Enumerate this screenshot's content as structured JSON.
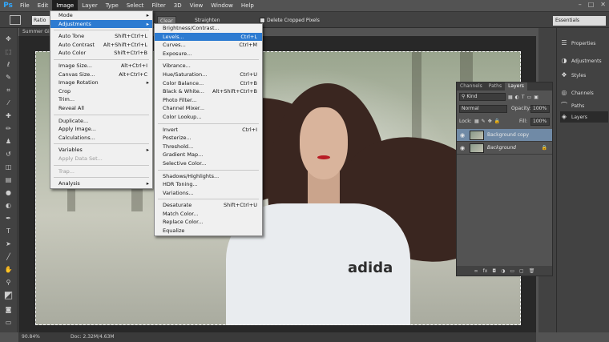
{
  "app": {
    "logo": "Ps"
  },
  "menubar": {
    "items": [
      "File",
      "Edit",
      "Image",
      "Layer",
      "Type",
      "Select",
      "Filter",
      "3D",
      "View",
      "Window",
      "Help"
    ],
    "active": "Image"
  },
  "options_bar": {
    "ratio": "Ratio",
    "clear": "Clear",
    "straighten": "Straighten",
    "delete_cropped": "Delete Cropped Pixels",
    "workspace": "Essentials"
  },
  "document": {
    "tab": "Summer Gi...",
    "zoom": "90.84%",
    "doc_size": "Doc: 2.32M/4.63M"
  },
  "image_menu": [
    {
      "label": "Mode",
      "submenu": true
    },
    {
      "label": "Adjustments",
      "submenu": true,
      "highlight": true
    },
    {
      "sep": true
    },
    {
      "label": "Auto Tone",
      "shortcut": "Shift+Ctrl+L"
    },
    {
      "label": "Auto Contrast",
      "shortcut": "Alt+Shift+Ctrl+L"
    },
    {
      "label": "Auto Color",
      "shortcut": "Shift+Ctrl+B"
    },
    {
      "sep": true
    },
    {
      "label": "Image Size...",
      "shortcut": "Alt+Ctrl+I"
    },
    {
      "label": "Canvas Size...",
      "shortcut": "Alt+Ctrl+C"
    },
    {
      "label": "Image Rotation",
      "submenu": true
    },
    {
      "label": "Crop"
    },
    {
      "label": "Trim..."
    },
    {
      "label": "Reveal All"
    },
    {
      "sep": true
    },
    {
      "label": "Duplicate..."
    },
    {
      "label": "Apply Image..."
    },
    {
      "label": "Calculations..."
    },
    {
      "sep": true
    },
    {
      "label": "Variables",
      "submenu": true
    },
    {
      "label": "Apply Data Set...",
      "disabled": true
    },
    {
      "sep": true
    },
    {
      "label": "Trap...",
      "disabled": true
    },
    {
      "sep": true
    },
    {
      "label": "Analysis",
      "submenu": true
    }
  ],
  "adjust_menu": [
    {
      "label": "Brightness/Contrast..."
    },
    {
      "label": "Levels...",
      "shortcut": "Ctrl+L",
      "highlight": true
    },
    {
      "label": "Curves...",
      "shortcut": "Ctrl+M"
    },
    {
      "label": "Exposure..."
    },
    {
      "sep": true
    },
    {
      "label": "Vibrance..."
    },
    {
      "label": "Hue/Saturation...",
      "shortcut": "Ctrl+U"
    },
    {
      "label": "Color Balance...",
      "shortcut": "Ctrl+B"
    },
    {
      "label": "Black & White...",
      "shortcut": "Alt+Shift+Ctrl+B"
    },
    {
      "label": "Photo Filter..."
    },
    {
      "label": "Channel Mixer..."
    },
    {
      "label": "Color Lookup..."
    },
    {
      "sep": true
    },
    {
      "label": "Invert",
      "shortcut": "Ctrl+I"
    },
    {
      "label": "Posterize..."
    },
    {
      "label": "Threshold..."
    },
    {
      "label": "Gradient Map..."
    },
    {
      "label": "Selective Color..."
    },
    {
      "sep": true
    },
    {
      "label": "Shadows/Highlights..."
    },
    {
      "label": "HDR Toning..."
    },
    {
      "label": "Variations..."
    },
    {
      "sep": true
    },
    {
      "label": "Desaturate",
      "shortcut": "Shift+Ctrl+U"
    },
    {
      "label": "Match Color..."
    },
    {
      "label": "Replace Color..."
    },
    {
      "label": "Equalize"
    }
  ],
  "right_panels": [
    {
      "label": "Properties",
      "icon": "properties-icon"
    },
    {
      "label": "Adjustments",
      "icon": "adjustments-icon"
    },
    {
      "label": "Styles",
      "icon": "styles-icon"
    },
    {
      "label": "Channels",
      "icon": "channels-icon"
    },
    {
      "label": "Paths",
      "icon": "paths-icon"
    },
    {
      "label": "Layers",
      "icon": "layers-icon",
      "active": true
    }
  ],
  "layers_panel": {
    "tabs": [
      "Channels",
      "Paths",
      "Layers"
    ],
    "active_tab": "Layers",
    "kind": "Kind",
    "blend_mode": "Normal",
    "opacity_label": "Opacity:",
    "opacity": "100%",
    "lock_label": "Lock:",
    "fill_label": "Fill:",
    "fill": "100%",
    "layers": [
      {
        "name": "Background copy",
        "selected": true
      },
      {
        "name": "Background",
        "locked": true
      }
    ]
  },
  "photo": {
    "logo_text": "adida"
  }
}
